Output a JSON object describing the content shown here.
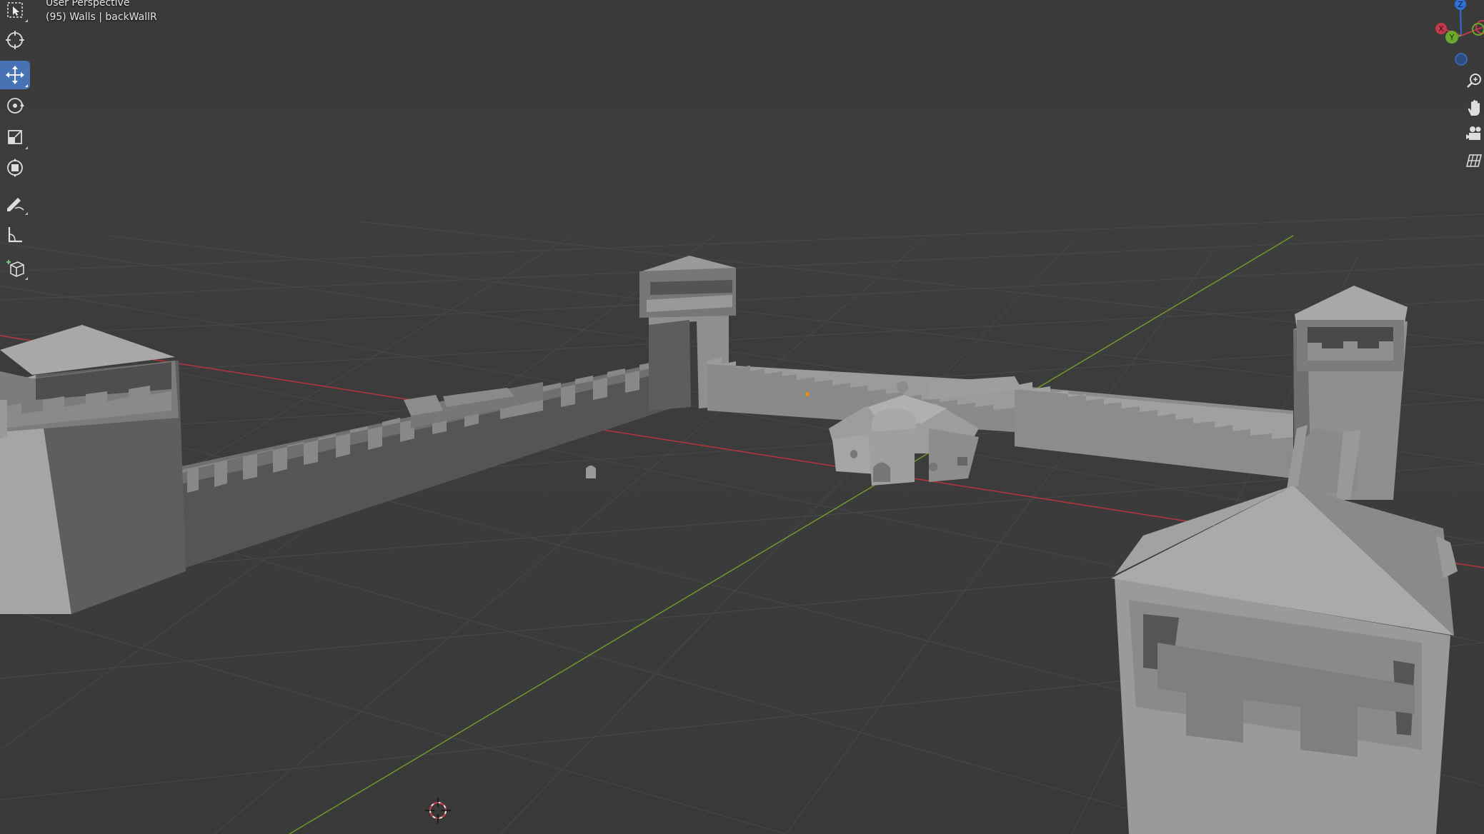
{
  "viewport": {
    "title": "User Perspective",
    "active_object": "(95) Walls | backWallR"
  },
  "toolbar": {
    "tools": [
      {
        "name": "select-box",
        "icon": "select-box-icon",
        "active": false
      },
      {
        "name": "cursor",
        "icon": "cursor-icon",
        "active": false
      },
      {
        "name": "move",
        "icon": "move-icon",
        "active": true
      },
      {
        "name": "rotate",
        "icon": "rotate-icon",
        "active": false
      },
      {
        "name": "scale",
        "icon": "scale-icon",
        "active": false
      },
      {
        "name": "transform",
        "icon": "transform-icon",
        "active": false
      },
      {
        "name": "annotate",
        "icon": "annotate-icon",
        "active": false
      },
      {
        "name": "measure",
        "icon": "measure-icon",
        "active": false
      },
      {
        "name": "add-cube",
        "icon": "add-cube-icon",
        "active": false
      }
    ]
  },
  "gizmo": {
    "axes": [
      {
        "label": "Z",
        "color": "#2f6fd6"
      },
      {
        "label": "Y",
        "color": "#6aa82c"
      },
      {
        "label": "X",
        "color": "#d23a4c"
      }
    ]
  },
  "nav_buttons": [
    {
      "name": "zoom",
      "icon": "zoom-icon"
    },
    {
      "name": "pan",
      "icon": "hand-icon"
    },
    {
      "name": "camera",
      "icon": "camera-icon"
    },
    {
      "name": "ortho",
      "icon": "grid-icon"
    }
  ],
  "colors": {
    "background": "#3d3d3d",
    "grid": "#4a4a4a",
    "x_axis": "#b8343d",
    "y_axis": "#6d9a2a",
    "active_tool": "#4772b3",
    "mesh": "#9a9a9a",
    "mesh_dark": "#6b6b6b",
    "mesh_shadow": "#575757"
  }
}
